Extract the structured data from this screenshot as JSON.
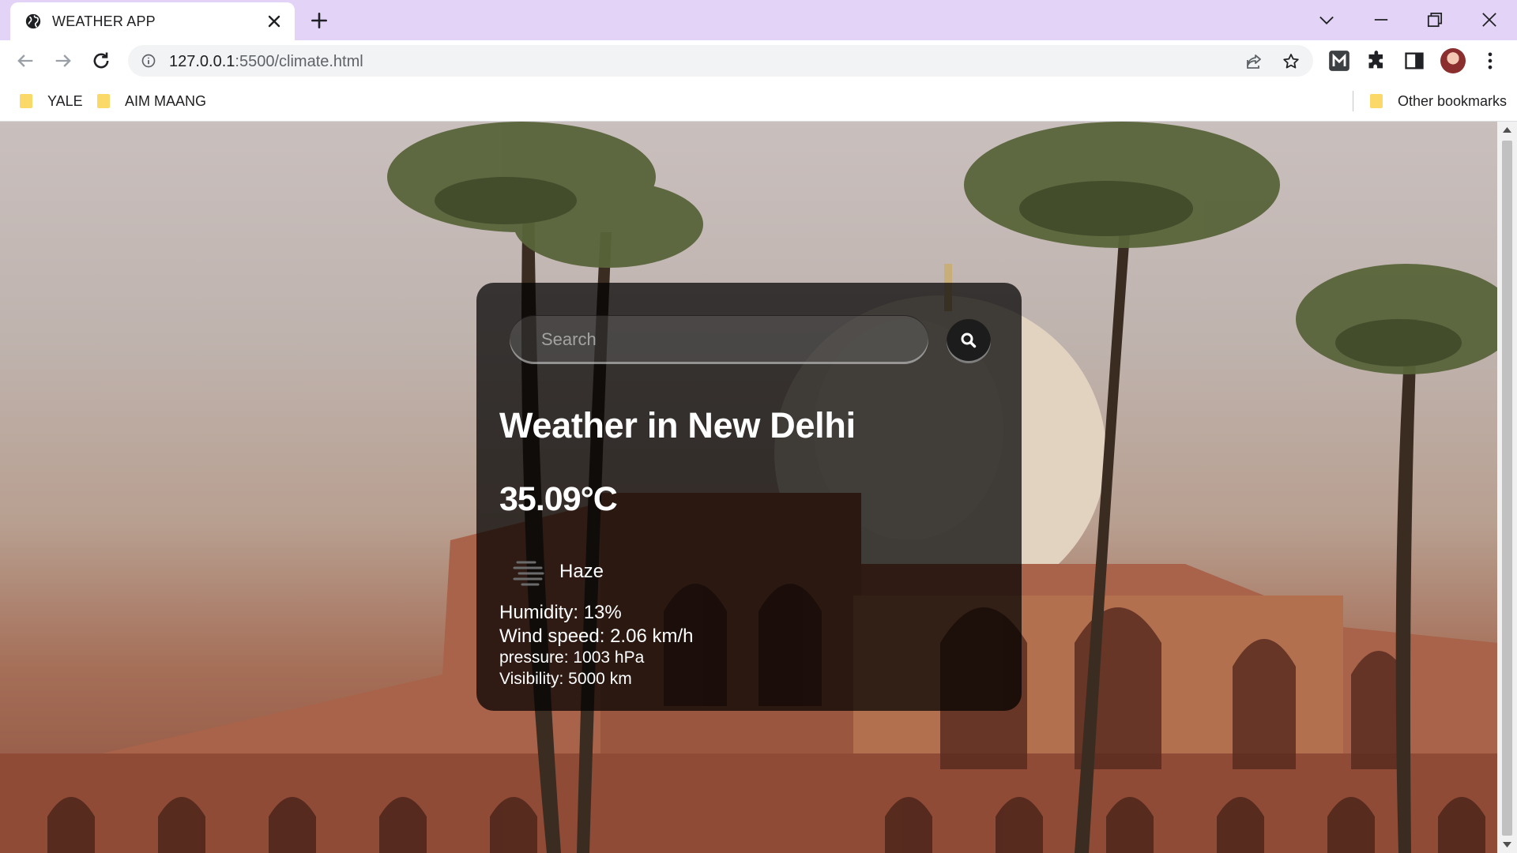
{
  "browser": {
    "tab_title": "WEATHER APP",
    "url_host": "127.0.0.1",
    "url_rest": ":5500/climate.html",
    "bookmarks": [
      "YALE",
      "AIM MAANG"
    ],
    "other_bookmarks": "Other bookmarks"
  },
  "weather": {
    "search_placeholder": "Search",
    "city_heading": "Weather in New Delhi",
    "temperature": "35.09°C",
    "condition": "Haze",
    "condition_icon": "haze-icon",
    "humidity": "Humidity: 13%",
    "wind": "Wind speed: 2.06 km/h",
    "pressure": "pressure: 1003 hPa",
    "visibility": "Visibility: 5000 km"
  },
  "colors": {
    "tabstrip": "#e3d3f7",
    "card": "rgba(0,0,0,0.72)",
    "text": "#ffffff"
  }
}
